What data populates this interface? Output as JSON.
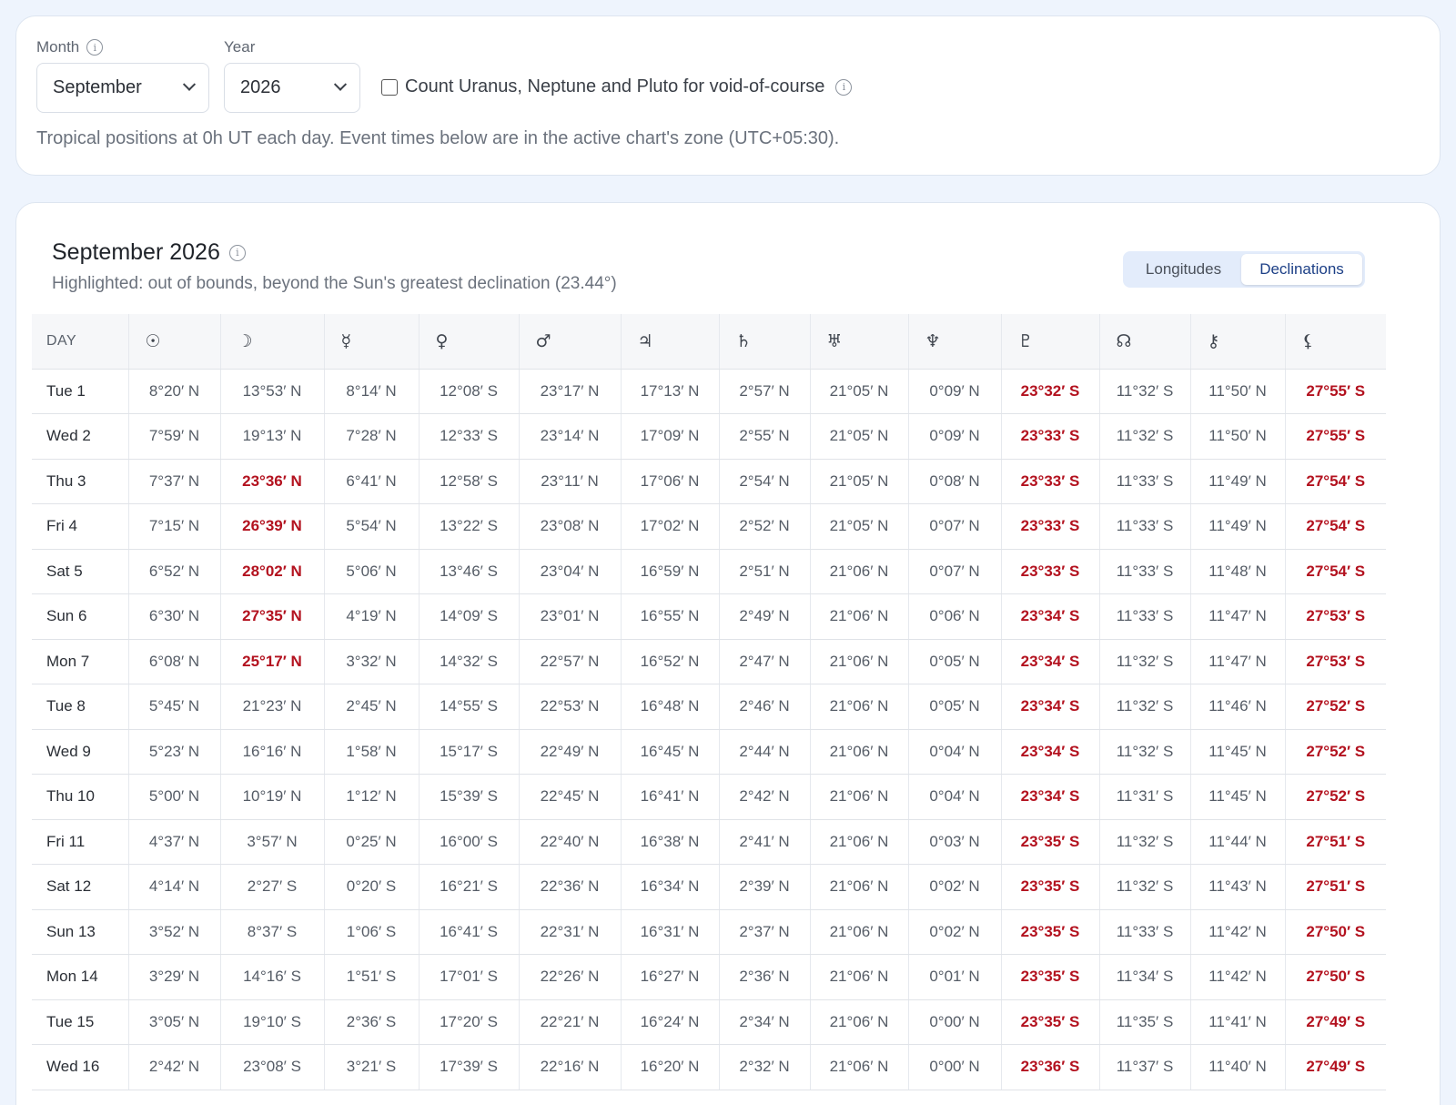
{
  "controls": {
    "month_label": "Month",
    "year_label": "Year",
    "month_value": "September",
    "year_value": "2026",
    "checkbox_label": "Count Uranus, Neptune and Pluto for void-of-course",
    "checkbox_checked": false,
    "hint": "Tropical positions at 0h UT each day. Event times below are in the active chart's zone (UTC+05:30)."
  },
  "table_section": {
    "title": "September 2026",
    "subtitle": "Highlighted: out of bounds, beyond the Sun's greatest declination (23.44°)",
    "toggle": {
      "longitudes": "Longitudes",
      "declinations": "Declinations",
      "active": "declinations"
    }
  },
  "colors": {
    "out_of_bounds": "#b3121f",
    "accent": "#1c3f86",
    "background": "#eef4fd"
  },
  "columns": [
    "DAY",
    "☉",
    "☽",
    "☿",
    "♀",
    "♂",
    "♃",
    "♄",
    "♅",
    "♆",
    "♇",
    "☊",
    "⚷",
    "⚸"
  ],
  "rows": [
    {
      "day": "Tue 1",
      "v": [
        "8°20′ N",
        "13°53′ N",
        "8°14′ N",
        "12°08′ S",
        "23°17′ N",
        "17°13′ N",
        "2°57′ N",
        "21°05′ N",
        "0°09′ N",
        "23°32′ S",
        "11°32′ S",
        "11°50′ N",
        "27°55′ S"
      ],
      "oob": [
        9,
        12
      ]
    },
    {
      "day": "Wed 2",
      "v": [
        "7°59′ N",
        "19°13′ N",
        "7°28′ N",
        "12°33′ S",
        "23°14′ N",
        "17°09′ N",
        "2°55′ N",
        "21°05′ N",
        "0°09′ N",
        "23°33′ S",
        "11°32′ S",
        "11°50′ N",
        "27°55′ S"
      ],
      "oob": [
        9,
        12
      ]
    },
    {
      "day": "Thu 3",
      "v": [
        "7°37′ N",
        "23°36′ N",
        "6°41′ N",
        "12°58′ S",
        "23°11′ N",
        "17°06′ N",
        "2°54′ N",
        "21°05′ N",
        "0°08′ N",
        "23°33′ S",
        "11°33′ S",
        "11°49′ N",
        "27°54′ S"
      ],
      "oob": [
        1,
        9,
        12
      ]
    },
    {
      "day": "Fri 4",
      "v": [
        "7°15′ N",
        "26°39′ N",
        "5°54′ N",
        "13°22′ S",
        "23°08′ N",
        "17°02′ N",
        "2°52′ N",
        "21°05′ N",
        "0°07′ N",
        "23°33′ S",
        "11°33′ S",
        "11°49′ N",
        "27°54′ S"
      ],
      "oob": [
        1,
        9,
        12
      ]
    },
    {
      "day": "Sat 5",
      "v": [
        "6°52′ N",
        "28°02′ N",
        "5°06′ N",
        "13°46′ S",
        "23°04′ N",
        "16°59′ N",
        "2°51′ N",
        "21°06′ N",
        "0°07′ N",
        "23°33′ S",
        "11°33′ S",
        "11°48′ N",
        "27°54′ S"
      ],
      "oob": [
        1,
        9,
        12
      ]
    },
    {
      "day": "Sun 6",
      "v": [
        "6°30′ N",
        "27°35′ N",
        "4°19′ N",
        "14°09′ S",
        "23°01′ N",
        "16°55′ N",
        "2°49′ N",
        "21°06′ N",
        "0°06′ N",
        "23°34′ S",
        "11°33′ S",
        "11°47′ N",
        "27°53′ S"
      ],
      "oob": [
        1,
        9,
        12
      ]
    },
    {
      "day": "Mon 7",
      "v": [
        "6°08′ N",
        "25°17′ N",
        "3°32′ N",
        "14°32′ S",
        "22°57′ N",
        "16°52′ N",
        "2°47′ N",
        "21°06′ N",
        "0°05′ N",
        "23°34′ S",
        "11°32′ S",
        "11°47′ N",
        "27°53′ S"
      ],
      "oob": [
        1,
        9,
        12
      ]
    },
    {
      "day": "Tue 8",
      "v": [
        "5°45′ N",
        "21°23′ N",
        "2°45′ N",
        "14°55′ S",
        "22°53′ N",
        "16°48′ N",
        "2°46′ N",
        "21°06′ N",
        "0°05′ N",
        "23°34′ S",
        "11°32′ S",
        "11°46′ N",
        "27°52′ S"
      ],
      "oob": [
        9,
        12
      ]
    },
    {
      "day": "Wed 9",
      "v": [
        "5°23′ N",
        "16°16′ N",
        "1°58′ N",
        "15°17′ S",
        "22°49′ N",
        "16°45′ N",
        "2°44′ N",
        "21°06′ N",
        "0°04′ N",
        "23°34′ S",
        "11°32′ S",
        "11°45′ N",
        "27°52′ S"
      ],
      "oob": [
        9,
        12
      ]
    },
    {
      "day": "Thu 10",
      "v": [
        "5°00′ N",
        "10°19′ N",
        "1°12′ N",
        "15°39′ S",
        "22°45′ N",
        "16°41′ N",
        "2°42′ N",
        "21°06′ N",
        "0°04′ N",
        "23°34′ S",
        "11°31′ S",
        "11°45′ N",
        "27°52′ S"
      ],
      "oob": [
        9,
        12
      ]
    },
    {
      "day": "Fri 11",
      "v": [
        "4°37′ N",
        "3°57′ N",
        "0°25′ N",
        "16°00′ S",
        "22°40′ N",
        "16°38′ N",
        "2°41′ N",
        "21°06′ N",
        "0°03′ N",
        "23°35′ S",
        "11°32′ S",
        "11°44′ N",
        "27°51′ S"
      ],
      "oob": [
        9,
        12
      ]
    },
    {
      "day": "Sat 12",
      "v": [
        "4°14′ N",
        "2°27′ S",
        "0°20′ S",
        "16°21′ S",
        "22°36′ N",
        "16°34′ N",
        "2°39′ N",
        "21°06′ N",
        "0°02′ N",
        "23°35′ S",
        "11°32′ S",
        "11°43′ N",
        "27°51′ S"
      ],
      "oob": [
        9,
        12
      ]
    },
    {
      "day": "Sun 13",
      "v": [
        "3°52′ N",
        "8°37′ S",
        "1°06′ S",
        "16°41′ S",
        "22°31′ N",
        "16°31′ N",
        "2°37′ N",
        "21°06′ N",
        "0°02′ N",
        "23°35′ S",
        "11°33′ S",
        "11°42′ N",
        "27°50′ S"
      ],
      "oob": [
        9,
        12
      ]
    },
    {
      "day": "Mon 14",
      "v": [
        "3°29′ N",
        "14°16′ S",
        "1°51′ S",
        "17°01′ S",
        "22°26′ N",
        "16°27′ N",
        "2°36′ N",
        "21°06′ N",
        "0°01′ N",
        "23°35′ S",
        "11°34′ S",
        "11°42′ N",
        "27°50′ S"
      ],
      "oob": [
        9,
        12
      ]
    },
    {
      "day": "Tue 15",
      "v": [
        "3°05′ N",
        "19°10′ S",
        "2°36′ S",
        "17°20′ S",
        "22°21′ N",
        "16°24′ N",
        "2°34′ N",
        "21°06′ N",
        "0°00′ N",
        "23°35′ S",
        "11°35′ S",
        "11°41′ N",
        "27°49′ S"
      ],
      "oob": [
        9,
        12
      ]
    },
    {
      "day": "Wed 16",
      "v": [
        "2°42′ N",
        "23°08′ S",
        "3°21′ S",
        "17°39′ S",
        "22°16′ N",
        "16°20′ N",
        "2°32′ N",
        "21°06′ N",
        "0°00′ N",
        "23°36′ S",
        "11°37′ S",
        "11°40′ N",
        "27°49′ S"
      ],
      "oob": [
        9,
        12
      ]
    }
  ]
}
